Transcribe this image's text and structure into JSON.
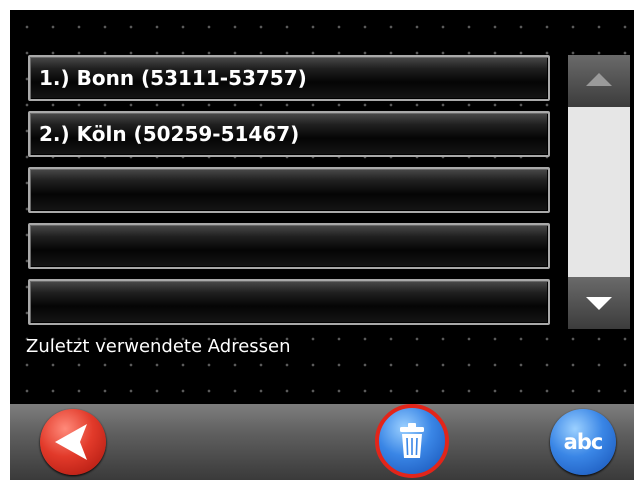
{
  "address_list": {
    "items": [
      {
        "label": "1.) Bonn (53111-53757)"
      },
      {
        "label": "2.) Köln (50259-51467)"
      },
      {
        "label": ""
      },
      {
        "label": ""
      },
      {
        "label": ""
      }
    ]
  },
  "caption": "Zuletzt verwendete Adressen",
  "toolbar": {
    "back_icon": "back-arrow-icon",
    "delete_icon": "trash-icon",
    "keyboard_label": "abc"
  },
  "colors": {
    "background": "#000000",
    "back_button": "#e23a2a",
    "action_button": "#3a86e6",
    "selected_outline": "#e2251a"
  }
}
